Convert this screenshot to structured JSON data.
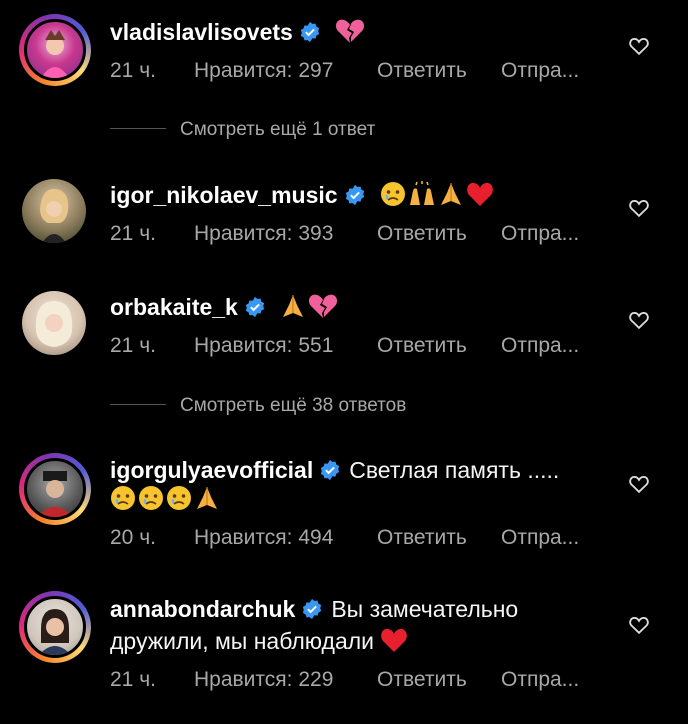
{
  "comments": [
    {
      "username": "vladislavlisovets",
      "text": "",
      "emoji": [
        "broken-heart"
      ],
      "time": "21 ч.",
      "likes": "Нравится: 297",
      "reply": "Ответить",
      "send": "Отпра..."
    },
    {
      "username": "igor_nikolaev_music",
      "text": "",
      "emoji": [
        "crying-face",
        "raising-hands",
        "folded-hands",
        "red-heart"
      ],
      "time": "21 ч.",
      "likes": "Нравится: 393",
      "reply": "Ответить",
      "send": "Отпра..."
    },
    {
      "username": "orbakaite_k",
      "text": "",
      "emoji": [
        "folded-hands",
        "broken-heart"
      ],
      "time": "21 ч.",
      "likes": "Нравится: 551",
      "reply": "Ответить",
      "send": "Отпра..."
    },
    {
      "username": "igorgulyaevofficial",
      "text": "Светлая память .....",
      "emoji": [
        "crying-face",
        "crying-face",
        "crying-face",
        "folded-hands"
      ],
      "time": "20 ч.",
      "likes": "Нравится: 494",
      "reply": "Ответить",
      "send": "Отпра..."
    },
    {
      "username": "annabondarchuk",
      "text": "Вы замечательно",
      "text_line2": "дружили, мы наблюдали",
      "emoji": [
        "red-heart"
      ],
      "time": "21 ч.",
      "likes": "Нравится: 229",
      "reply": "Ответить",
      "send": "Отпра..."
    }
  ],
  "view_more": [
    "Смотреть ещё 1 ответ",
    "Смотреть ещё 38 ответов"
  ],
  "colors": {
    "background": "#000000",
    "verified": "#3897f0",
    "muted": "#a8a8a8",
    "heart_red": "#e0245e"
  }
}
